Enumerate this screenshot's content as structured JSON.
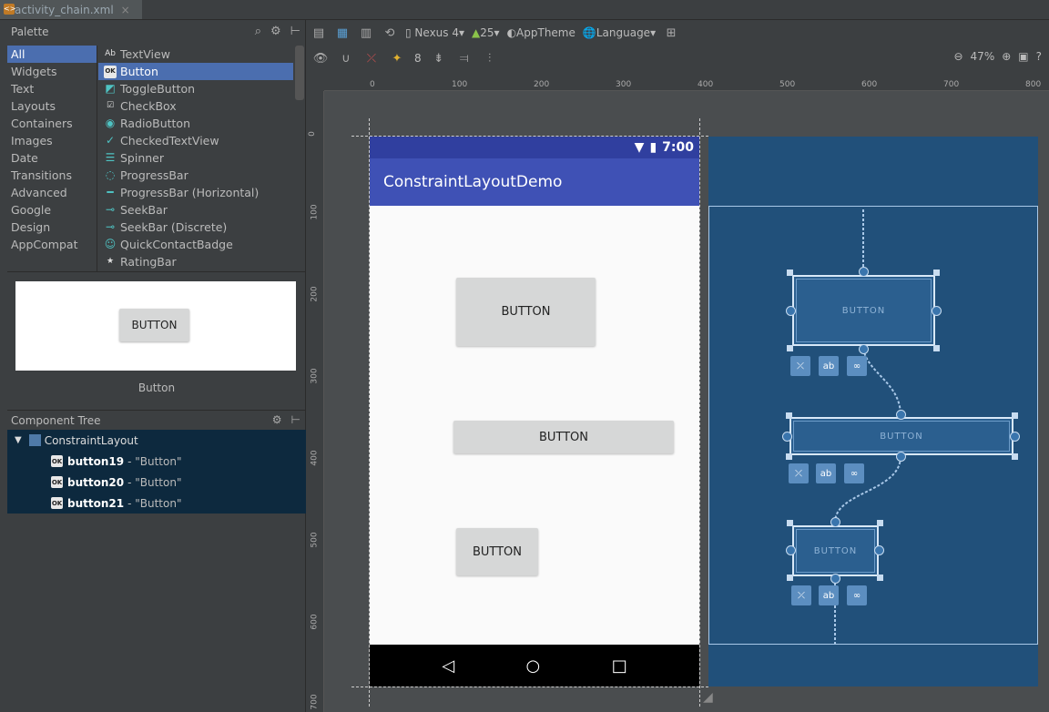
{
  "tab": {
    "title": "activity_chain.xml",
    "close": "×",
    "icon": "xml-file-icon"
  },
  "palette": {
    "title": "Palette",
    "categories": [
      "All",
      "Widgets",
      "Text",
      "Layouts",
      "Containers",
      "Images",
      "Date",
      "Transitions",
      "Advanced",
      "Google",
      "Design",
      "AppCompat"
    ],
    "selected_category": "All",
    "items": [
      {
        "icon": "Ab",
        "label": "TextView"
      },
      {
        "icon": "OK",
        "label": "Button"
      },
      {
        "icon": "◩",
        "label": "ToggleButton"
      },
      {
        "icon": "☑",
        "label": "CheckBox"
      },
      {
        "icon": "◉",
        "label": "RadioButton"
      },
      {
        "icon": "✓",
        "label": "CheckedTextView"
      },
      {
        "icon": "☰",
        "label": "Spinner"
      },
      {
        "icon": "◌",
        "label": "ProgressBar"
      },
      {
        "icon": "━",
        "label": "ProgressBar (Horizontal)"
      },
      {
        "icon": "⊸",
        "label": "SeekBar"
      },
      {
        "icon": "⊸",
        "label": "SeekBar (Discrete)"
      },
      {
        "icon": "☺",
        "label": "QuickContactBadge"
      },
      {
        "icon": "★",
        "label": "RatingBar"
      }
    ],
    "selected_item": "Button",
    "preview_button": "BUTTON",
    "preview_label": "Button"
  },
  "component_tree": {
    "title": "Component Tree",
    "root": "ConstraintLayout",
    "children": [
      {
        "id": "button19",
        "desc": "- \"Button\""
      },
      {
        "id": "button20",
        "desc": "- \"Button\""
      },
      {
        "id": "button21",
        "desc": "- \"Button\""
      }
    ]
  },
  "toolbar": {
    "device": "Nexus 4",
    "api": "25",
    "theme": "AppTheme",
    "language": "Language",
    "margin": "8",
    "zoom": "47%"
  },
  "ruler": {
    "top": [
      "0",
      "100",
      "200",
      "300",
      "400",
      "500",
      "600",
      "700",
      "800"
    ],
    "left": [
      "0",
      "100",
      "200",
      "300",
      "400",
      "500",
      "600",
      "700"
    ]
  },
  "phone": {
    "time": "7:00",
    "app_title": "ConstraintLayoutDemo",
    "buttons": [
      "BUTTON",
      "BUTTON",
      "BUTTON"
    ],
    "nav": [
      "◁",
      "○",
      "□"
    ]
  },
  "blueprint": {
    "buttons": [
      "BUTTON",
      "BUTTON",
      "BUTTON"
    ],
    "colors": {
      "bg": "#21507a",
      "line": "#a9c8e8"
    }
  }
}
